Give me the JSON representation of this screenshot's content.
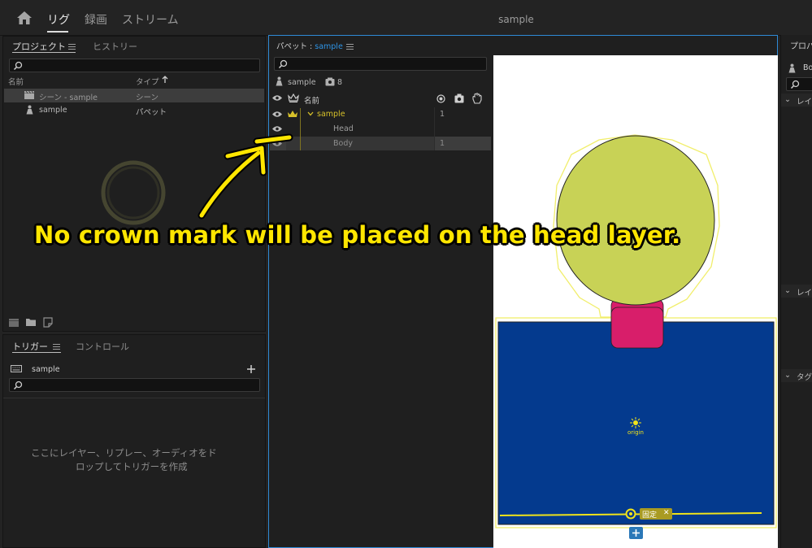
{
  "topbar": {
    "tabs": [
      "リグ",
      "録画",
      "ストリーム"
    ],
    "title": "sample"
  },
  "project_panel": {
    "tabs": [
      "プロジェクト",
      "ヒストリー"
    ],
    "col_name": "名前",
    "col_type": "タイプ",
    "items": [
      {
        "name": "シーン - sample",
        "type": "シーン"
      },
      {
        "name": "sample",
        "type": "パペット"
      }
    ]
  },
  "trigger_panel": {
    "tabs": [
      "トリガー",
      "コントロール"
    ],
    "puppet": "sample",
    "empty_message_line1": "ここにレイヤー、リプレー、オーディオをド",
    "empty_message_line2": "ロップしてトリガーを作成"
  },
  "puppet_panel": {
    "title_prefix": "パペット : ",
    "title_name": "sample",
    "puppet_name": "sample",
    "layer_count": "8",
    "col_name": "名前",
    "layers": [
      {
        "name": "sample",
        "value": "1",
        "crown": true
      },
      {
        "name": "Head",
        "value": "",
        "crown": false
      },
      {
        "name": "Body",
        "value": "1",
        "crown": false
      }
    ]
  },
  "canvas": {
    "origin_label": "origin",
    "fixed_label": "固定",
    "head_color": "#c8d256",
    "neck_color": "#d81e6a",
    "body_color": "#043a8e",
    "handle_color": "#f0e31a"
  },
  "props_panel": {
    "tab": "プロパ",
    "item": "Bo",
    "sections": [
      "レイ",
      "レイ",
      "タグ"
    ]
  },
  "annotation": {
    "text": "No crown mark will be placed on the head layer."
  }
}
